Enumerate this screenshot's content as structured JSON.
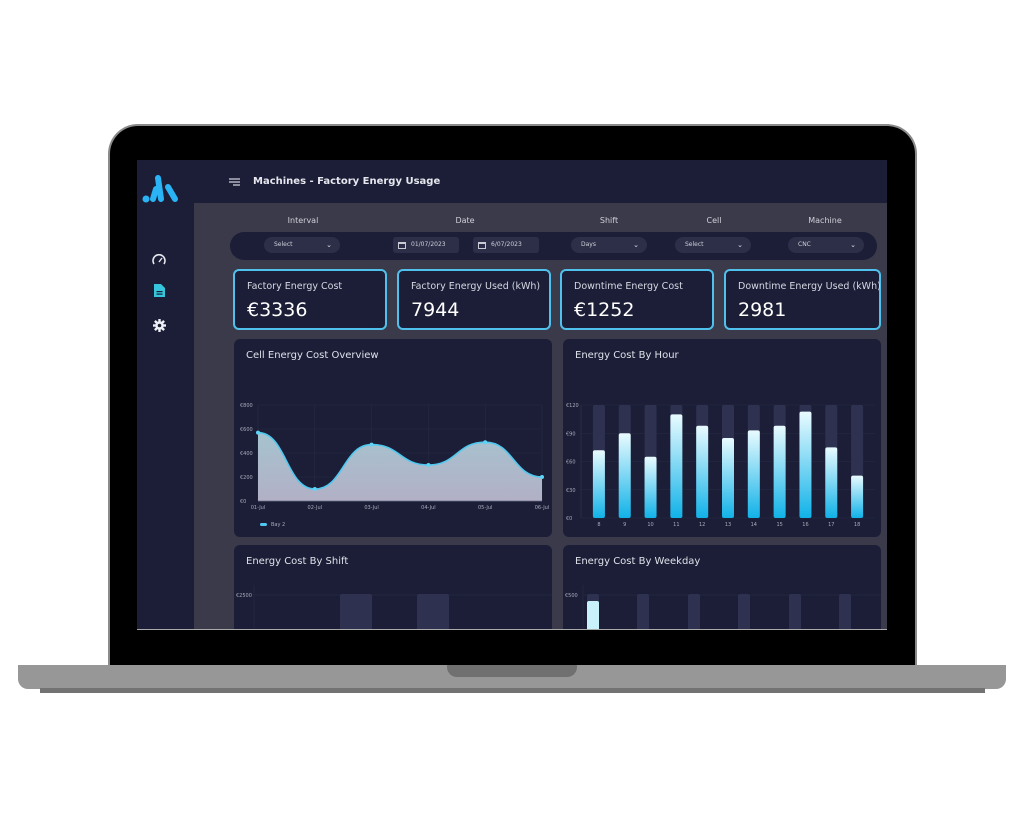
{
  "header": {
    "title": "Machines - Factory Energy Usage"
  },
  "sidebar": {
    "items": [
      {
        "icon": "speedometer-icon",
        "label": "Dashboard"
      },
      {
        "icon": "document-icon",
        "label": "Reports",
        "active": true
      },
      {
        "icon": "gear-icon",
        "label": "Settings"
      }
    ]
  },
  "filters": {
    "interval": {
      "label": "Interval",
      "value": "Select"
    },
    "date": {
      "label": "Date",
      "from": "01/07/2023",
      "to": "6/07/2023"
    },
    "shift": {
      "label": "Shift",
      "value": "Days"
    },
    "cell": {
      "label": "Cell",
      "value": "Select"
    },
    "machine": {
      "label": "Machine",
      "value": "CNC"
    }
  },
  "kpis": [
    {
      "title": "Factory Energy Cost",
      "value": "€3336"
    },
    {
      "title": "Factory Energy Used (kWh)",
      "value": "7944"
    },
    {
      "title": "Downtime Energy Cost",
      "value": "€1252"
    },
    {
      "title": "Downtime Energy Used (kWh)",
      "value": "2981"
    }
  ],
  "colors": {
    "accent": "#4fc1ec",
    "panel": "#1b1e36",
    "background": "#3b3a4a"
  },
  "chart_data": [
    {
      "type": "area",
      "title": "Cell Energy Cost  Overview",
      "categories": [
        "01-Jul",
        "02-Jul",
        "03-Jul",
        "04-Jul",
        "05-Jul",
        "06-Jul"
      ],
      "series": [
        {
          "name": "Bay 2",
          "values": [
            570,
            100,
            470,
            300,
            490,
            200
          ]
        }
      ],
      "yticks": [
        "€0",
        "€200",
        "€400",
        "€600",
        "€800"
      ],
      "ylim": [
        0,
        800
      ],
      "legend": "bottom-left",
      "grid": true
    },
    {
      "type": "bar",
      "title": "Energy Cost  By Hour",
      "categories": [
        "8",
        "9",
        "10",
        "11",
        "12",
        "13",
        "14",
        "15",
        "16",
        "17",
        "18"
      ],
      "values": [
        72,
        90,
        65,
        110,
        98,
        85,
        93,
        98,
        113,
        75,
        45
      ],
      "yticks": [
        "€0",
        "€30",
        "€60",
        "€90",
        "€120"
      ],
      "ylim": [
        0,
        120
      ],
      "grid": true
    },
    {
      "type": "bar",
      "title": "Energy Cost  By Shift",
      "yticks_visible": [
        "€2500"
      ],
      "note": "partially visible"
    },
    {
      "type": "bar",
      "title": "Energy Cost By Weekday",
      "yticks_visible": [
        "€500"
      ],
      "note": "partially visible"
    }
  ]
}
